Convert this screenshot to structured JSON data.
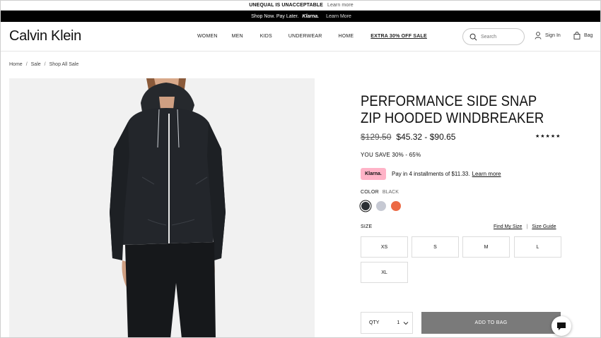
{
  "announcement": {
    "text": "UNEQUAL IS UNACCEPTABLE",
    "link": "Learn more"
  },
  "promo": {
    "text": "Shop Now. Pay Later.",
    "brand": "Klarna.",
    "link": "Learn More"
  },
  "header": {
    "logo": "Calvin Klein",
    "nav": [
      "WOMEN",
      "MEN",
      "KIDS",
      "UNDERWEAR",
      "HOME",
      "EXTRA 30% OFF SALE"
    ],
    "search_placeholder": "Search",
    "sign_in": "Sign In",
    "bag": "Bag"
  },
  "breadcrumb": [
    "Home",
    "Sale",
    "Shop All Sale"
  ],
  "breadcrumb_separator": "/",
  "product": {
    "title": "PERFORMANCE SIDE SNAP ZIP HOODED WINDBREAKER",
    "original_price": "$129.50",
    "price_range": "$45.32 - $90.65",
    "stars": "★★★★★",
    "savings": "YOU SAVE 30% - 65%",
    "klarna_badge": "Klarna.",
    "klarna_text": "Pay in 4 installments of $11.33.",
    "klarna_link": "Learn more",
    "color_label": "COLOR",
    "color_value": "BLACK",
    "swatch_colors": [
      "#2c3034",
      "#c6c9d3",
      "#ec6a45"
    ],
    "size_label": "SIZE",
    "find_my_size": "Find My Size",
    "size_guide": "Size Guide",
    "sizes": [
      "XS",
      "S",
      "M",
      "L",
      "XL"
    ],
    "qty_label": "QTY",
    "qty_value": "1",
    "add_to_bag": "ADD TO BAG"
  }
}
